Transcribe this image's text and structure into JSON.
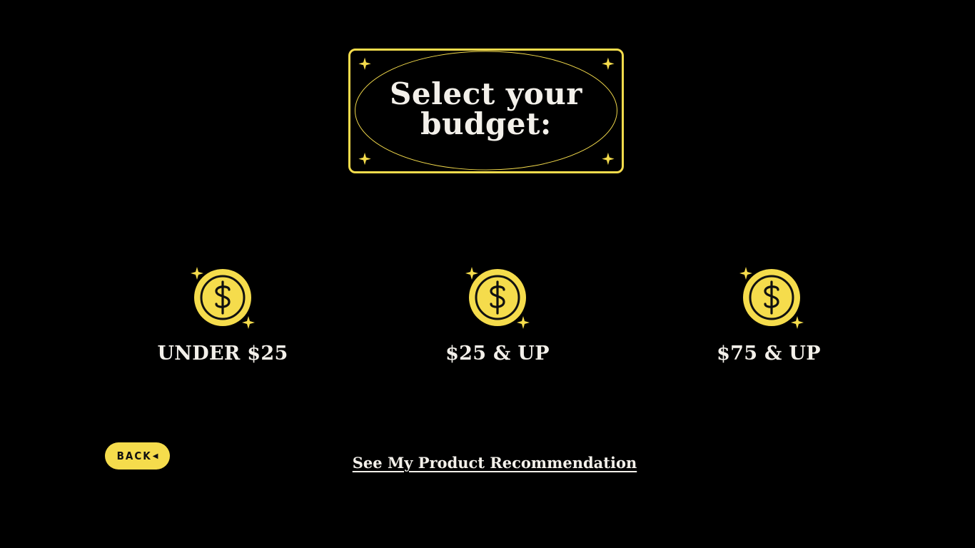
{
  "title": {
    "line1": "Select your",
    "line2": "budget:"
  },
  "options": [
    {
      "label": "UNDER $25",
      "icon": "dollar-coin-icon"
    },
    {
      "label": "$25 & UP",
      "icon": "dollar-coin-icon"
    },
    {
      "label": "$75 & UP",
      "icon": "dollar-coin-icon"
    }
  ],
  "back_button": {
    "label": "BACK",
    "icon": "left-arrow-icon"
  },
  "recommendation_link": {
    "label": "See My Product Recommendation"
  },
  "colors": {
    "background": "#000000",
    "accent": "#f5dc4c",
    "text": "#f3f0ea"
  }
}
